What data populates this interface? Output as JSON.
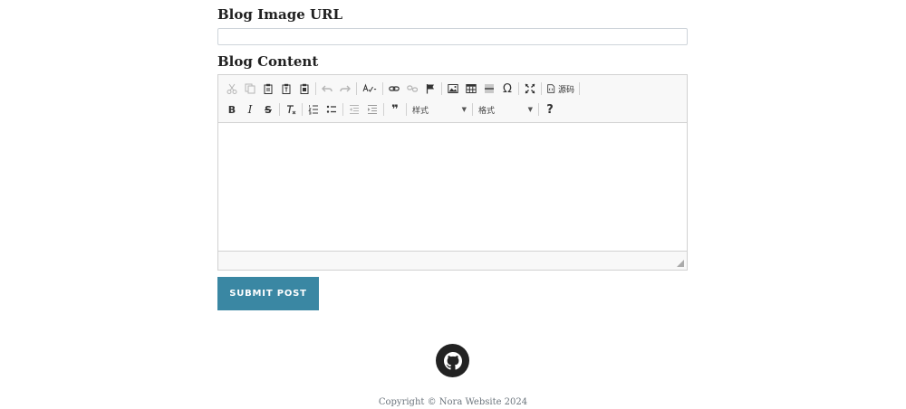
{
  "form": {
    "image_url_label": "Blog Image URL",
    "image_url_value": "",
    "content_label": "Blog Content",
    "submit_label": "SUBMIT POST"
  },
  "editor": {
    "source_label": "源码",
    "styles_label": "样式",
    "format_label": "格式",
    "help_label": "?",
    "bold_label": "B",
    "italic_label": "I",
    "strike_label": "S",
    "special_char_label": "Ω",
    "blockquote_label": "❞",
    "content": "",
    "toolbar_row1_icons": [
      "cut-icon",
      "copy-icon",
      "paste-icon",
      "paste-text-icon",
      "paste-word-icon",
      "undo-icon",
      "redo-icon",
      "spellcheck-icon",
      "link-icon",
      "unlink-icon",
      "anchor-icon",
      "image-icon",
      "table-icon",
      "horizontal-rule-icon",
      "special-char-icon",
      "maximize-icon",
      "source-icon"
    ],
    "toolbar_row2_icons": [
      "bold-icon",
      "italic-icon",
      "strike-icon",
      "remove-format-icon",
      "numbered-list-icon",
      "bulleted-list-icon",
      "outdent-icon",
      "indent-icon",
      "blockquote-icon",
      "help-icon"
    ]
  },
  "footer": {
    "copyright": "Copyright © Nora Website 2024",
    "github_icon": "github-icon"
  },
  "colors": {
    "submit_bg": "#3a87a3",
    "github_bg": "#222222"
  }
}
